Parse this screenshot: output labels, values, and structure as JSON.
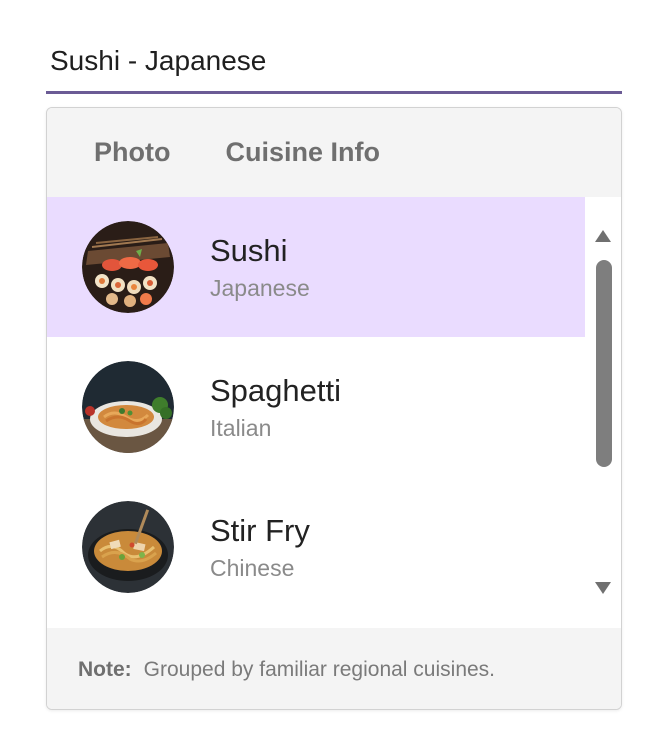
{
  "combobox": {
    "value": "Sushi - Japanese",
    "accent_color": "#6b5b95"
  },
  "dropdown": {
    "columns": {
      "photo": "Photo",
      "info": "Cuisine Info"
    },
    "items": [
      {
        "name": "Sushi",
        "cuisine": "Japanese",
        "selected": true,
        "photo": "sushi-photo"
      },
      {
        "name": "Spaghetti",
        "cuisine": "Italian",
        "selected": false,
        "photo": "spaghetti-photo"
      },
      {
        "name": "Stir Fry",
        "cuisine": "Chinese",
        "selected": false,
        "photo": "stir-fry-photo"
      }
    ],
    "selected_color": "#eadcff",
    "footer": {
      "label": "Note:",
      "text": "Grouped by familiar regional cuisines."
    }
  }
}
